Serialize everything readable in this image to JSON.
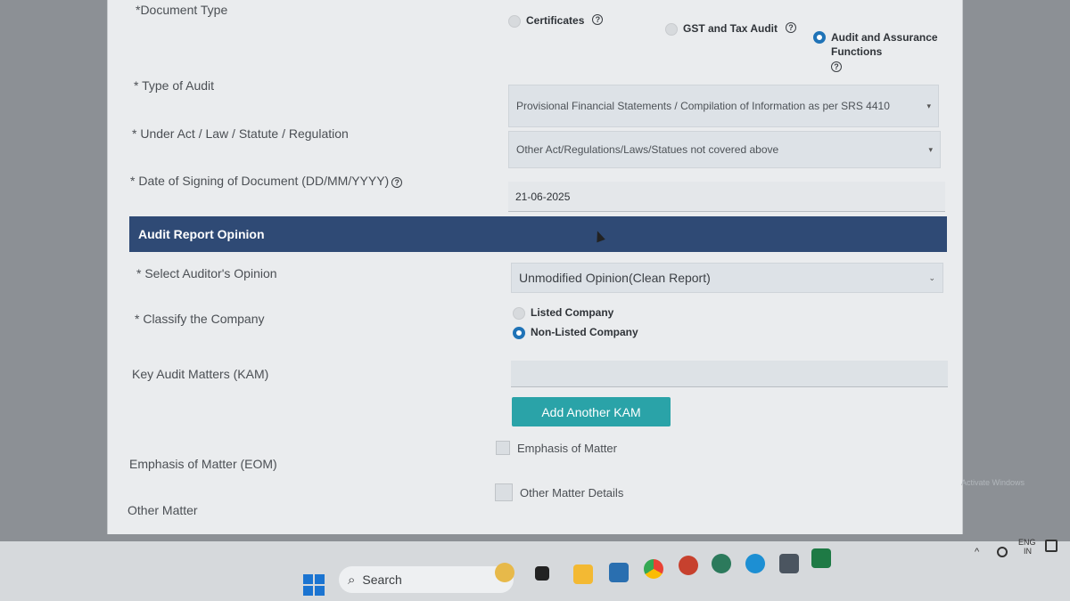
{
  "form": {
    "document_type_label": "*Document Type",
    "doc_types": [
      {
        "label": "Certificates",
        "selected": false
      },
      {
        "label": "GST and Tax Audit",
        "selected": false
      },
      {
        "label_line1": "Audit and Assurance",
        "label_line2": "Functions",
        "selected": true
      }
    ],
    "type_of_audit_label": "* Type of Audit",
    "type_of_audit_value": "Provisional Financial Statements / Compilation of Information as per SRS 4410",
    "under_act_label": "* Under Act / Law / Statute / Regulation",
    "under_act_value": "Other Act/Regulations/Laws/Statues not covered above",
    "date_label": "* Date of Signing of Document (DD/MM/YYYY)",
    "date_value": "21-06-2025"
  },
  "opinion_section": {
    "title": "Audit Report Opinion",
    "auditor_opinion_label": "* Select Auditor's Opinion",
    "auditor_opinion_value": "Unmodified Opinion(Clean Report)",
    "classify_label": "* Classify the Company",
    "classify_options": [
      {
        "label": "Listed Company",
        "selected": false
      },
      {
        "label": "Non-Listed Company",
        "selected": true
      }
    ],
    "kam_label": "Key Audit Matters (KAM)",
    "add_kam_button": "Add Another KAM",
    "eom_label": "Emphasis of Matter (EOM)",
    "eom_checkbox": "Emphasis of Matter",
    "other_matter_label": "Other Matter",
    "other_matter_checkbox": "Other Matter Details"
  },
  "watermark": {
    "line1": "Activate Windows"
  },
  "taskbar": {
    "search_placeholder": "Search",
    "tray_lang": "ENG",
    "tray_region": "IN"
  },
  "colors": {
    "section_bar": "#2f4a75",
    "button": "#2aa3a8",
    "radio_selected": "#1f73b7"
  }
}
